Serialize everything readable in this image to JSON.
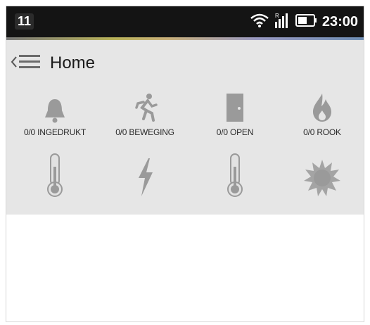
{
  "status_bar": {
    "notification_count": "11",
    "time": "23:00",
    "icons": [
      "wifi-icon",
      "signal-icon",
      "battery-icon"
    ]
  },
  "action_bar": {
    "title": "Home",
    "up_icon": "back-menu-icon"
  },
  "tiles_row1": [
    {
      "label": "0/0 INGEDRUKT",
      "icon": "bell-icon"
    },
    {
      "label": "0/0 BEWEGING",
      "icon": "running-person-icon"
    },
    {
      "label": "0/0 OPEN",
      "icon": "door-icon"
    },
    {
      "label": "0/0 ROOK",
      "icon": "flame-icon"
    }
  ],
  "tiles_row2": [
    {
      "icon": "thermometer-icon"
    },
    {
      "icon": "lightning-icon"
    },
    {
      "icon": "thermometer-icon"
    },
    {
      "icon": "sun-icon"
    }
  ],
  "colors": {
    "status_bar_bg": "#141414",
    "action_bar_bg": "#e6e6e6",
    "icon_gray": "#9a9a9a"
  }
}
